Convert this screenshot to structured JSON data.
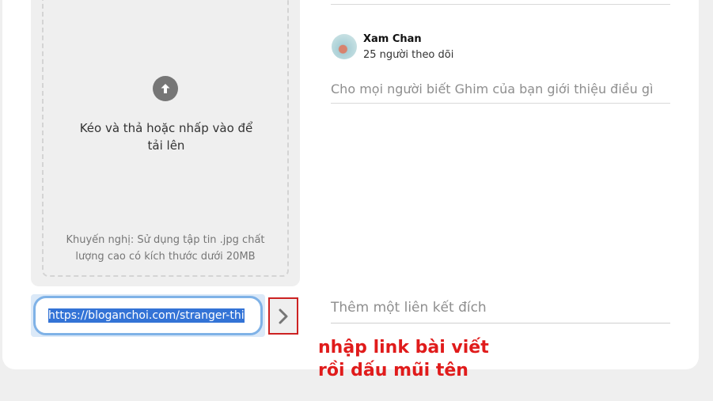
{
  "upload": {
    "icon": "arrow-up-circle-icon",
    "instruction": "Kéo và thả hoặc nhấp vào để tải lên",
    "hint": "Khuyến nghị: Sử dụng tập tin .jpg chất lượng cao có kích thước dưới 20MB"
  },
  "url_input": {
    "value": "https://bloganchoi.com/stranger-thi"
  },
  "submit_arrow": {
    "icon": "chevron-right-icon"
  },
  "profile": {
    "name": "Xam Chan",
    "followers": "25 người theo dõi"
  },
  "description": {
    "placeholder": "Cho mọi người biết Ghim của bạn giới thiệu điều gì"
  },
  "destination_link": {
    "placeholder": "Thêm một liên kết đích"
  },
  "annotation": {
    "line1": "nhập link bài viết",
    "line2": "rồi dấu mũi tên"
  },
  "colors": {
    "annotation": "#e01b1b",
    "selection": "#3373d6",
    "focus_ring": "#7fb2e7"
  }
}
